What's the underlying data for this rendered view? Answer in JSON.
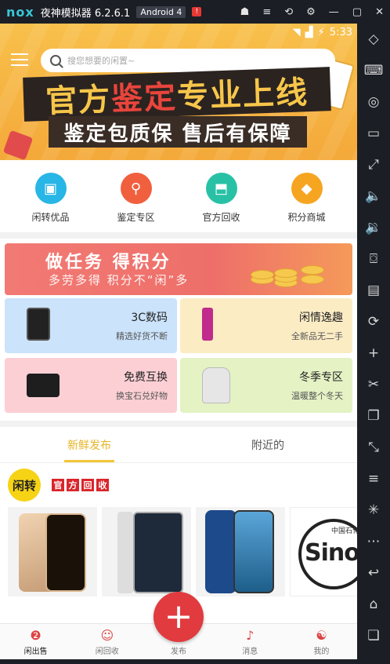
{
  "emulator": {
    "logo": "nox",
    "title": "夜神模拟器 6.2.6.1",
    "android_badge": "Android 4",
    "alert": "!",
    "controls": [
      "☗",
      "≡",
      "⟲",
      "⚙",
      "—",
      "▢",
      "✕"
    ],
    "side_icons": [
      "shake-icon",
      "keyboard-icon",
      "location-icon",
      "screen-icon",
      "fullscreen-icon",
      "volume-up-icon",
      "volume-down-icon",
      "screenshot-icon",
      "install-icon",
      "rotate-icon",
      "fps-icon",
      "cut-icon",
      "multi-icon",
      "expand-icon",
      "menu-icon",
      "loading-icon",
      "more-icon",
      "back-icon",
      "home-icon",
      "recents-icon"
    ],
    "side_glyphs": [
      "◇",
      "⌨",
      "◎",
      "▭",
      "⤢",
      "🔈",
      "🔉",
      "⌼",
      "▤",
      "⟳",
      "+",
      "✂",
      "❐",
      "⤡",
      "≡",
      "✳",
      "⋯",
      "↩",
      "⌂",
      "❏"
    ]
  },
  "status_bar": {
    "time": "5:33"
  },
  "search": {
    "placeholder": "搜您想要的闲置~"
  },
  "banner": {
    "line1_a": "官方",
    "line1_b": "鉴定",
    "line1_c": " 专业 ",
    "line1_d": "上线",
    "line2": "鉴定包质保 售后有保障"
  },
  "categories": [
    {
      "label": "闲转优品",
      "color": "#28b6e6",
      "glyph": "▣"
    },
    {
      "label": "鉴定专区",
      "color": "#f0603e",
      "glyph": "⚲"
    },
    {
      "label": "官方回收",
      "color": "#29c1a6",
      "glyph": "⬒"
    },
    {
      "label": "积分商城",
      "color": "#f6a521",
      "glyph": "◆"
    }
  ],
  "task_banner": {
    "title": "做任务 得积分",
    "subtitle": "多劳多得 积分不“闲”多"
  },
  "tiles": [
    {
      "title": "3C数码",
      "subtitle": "精选好货不断",
      "bg": "#cbe3fb"
    },
    {
      "title": "闲情逸趣",
      "subtitle": "全新品无二手",
      "bg": "#fbecc4"
    },
    {
      "title": "免费互换",
      "subtitle": "换宝石兑好物",
      "bg": "#fbcfd4"
    },
    {
      "title": "冬季专区",
      "subtitle": "温暖整个冬天",
      "bg": "#e4f2c4"
    }
  ],
  "feed_tabs": [
    {
      "label": "新鲜发布",
      "active": true
    },
    {
      "label": "附近的",
      "active": false
    }
  ],
  "recycle": {
    "logo_text": "闲转",
    "tag_chars": [
      "官",
      "方",
      "回",
      "收"
    ]
  },
  "products": [
    "iPhone XS Gold",
    "iPad Pro",
    "Smartphone Blue",
    "SINOPEC"
  ],
  "products_visible": {
    "p4_text": "中国石化",
    "p4_brand": "Sinope"
  },
  "fab": {
    "label": "+"
  },
  "bottom_nav": [
    {
      "label": "闲出售",
      "icon": "sell-icon",
      "glyph": "❷",
      "active": true
    },
    {
      "label": "闲回收",
      "icon": "recycle-icon",
      "glyph": "☺",
      "active": false
    },
    {
      "label": "发布",
      "icon": "publish-icon",
      "glyph": "",
      "active": false
    },
    {
      "label": "消息",
      "icon": "message-icon",
      "glyph": "♪",
      "active": false
    },
    {
      "label": "我的",
      "icon": "profile-icon",
      "glyph": "☯",
      "active": false
    }
  ]
}
